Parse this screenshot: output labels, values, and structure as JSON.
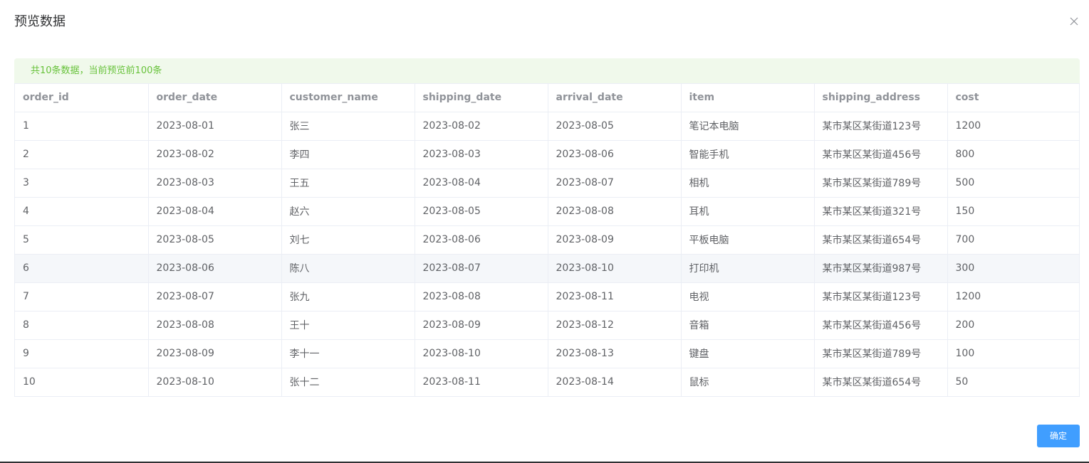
{
  "dialog": {
    "title": "预览数据",
    "alert_text": "共10条数据，当前预览前100条",
    "confirm_label": "确定",
    "close_icon": "close-icon"
  },
  "table": {
    "columns": [
      "order_id",
      "order_date",
      "customer_name",
      "shipping_date",
      "arrival_date",
      "item",
      "shipping_address",
      "cost"
    ],
    "rows": [
      [
        "1",
        "2023-08-01",
        "张三",
        "2023-08-02",
        "2023-08-05",
        "笔记本电脑",
        "某市某区某街道123号",
        "1200"
      ],
      [
        "2",
        "2023-08-02",
        "李四",
        "2023-08-03",
        "2023-08-06",
        "智能手机",
        "某市某区某街道456号",
        "800"
      ],
      [
        "3",
        "2023-08-03",
        "王五",
        "2023-08-04",
        "2023-08-07",
        "相机",
        "某市某区某街道789号",
        "500"
      ],
      [
        "4",
        "2023-08-04",
        "赵六",
        "2023-08-05",
        "2023-08-08",
        "耳机",
        "某市某区某街道321号",
        "150"
      ],
      [
        "5",
        "2023-08-05",
        "刘七",
        "2023-08-06",
        "2023-08-09",
        "平板电脑",
        "某市某区某街道654号",
        "700"
      ],
      [
        "6",
        "2023-08-06",
        "陈八",
        "2023-08-07",
        "2023-08-10",
        "打印机",
        "某市某区某街道987号",
        "300"
      ],
      [
        "7",
        "2023-08-07",
        "张九",
        "2023-08-08",
        "2023-08-11",
        "电视",
        "某市某区某街道123号",
        "1200"
      ],
      [
        "8",
        "2023-08-08",
        "王十",
        "2023-08-09",
        "2023-08-12",
        "音箱",
        "某市某区某街道456号",
        "200"
      ],
      [
        "9",
        "2023-08-09",
        "李十一",
        "2023-08-10",
        "2023-08-13",
        "键盘",
        "某市某区某街道789号",
        "100"
      ],
      [
        "10",
        "2023-08-10",
        "张十二",
        "2023-08-11",
        "2023-08-14",
        "鼠标",
        "某市某区某街道654号",
        "50"
      ]
    ],
    "hovered_row": 5
  },
  "colors": {
    "alert_bg": "#f0f9eb",
    "alert_text": "#67c23a",
    "primary": "#409eff",
    "header_text": "#909399",
    "cell_text": "#606266",
    "hover_bg": "#f5f7fa"
  }
}
